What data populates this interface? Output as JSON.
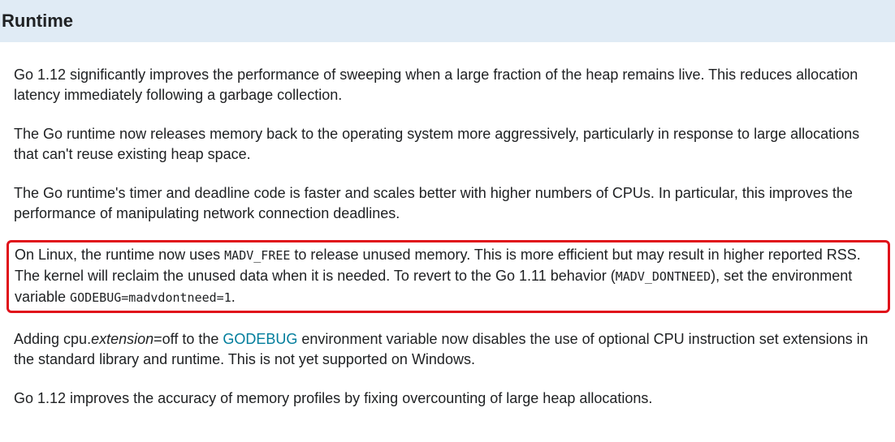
{
  "section": {
    "title": "Runtime"
  },
  "paragraphs": {
    "p1": "Go 1.12 significantly improves the performance of sweeping when a large fraction of the heap remains live. This reduces allocation latency immediately following a garbage collection.",
    "p2": "The Go runtime now releases memory back to the operating system more aggressively, particularly in response to large allocations that can't reuse existing heap space.",
    "p3": "The Go runtime's timer and deadline code is faster and scales better with higher numbers of CPUs. In particular, this improves the performance of manipulating network connection deadlines.",
    "p4": {
      "t1": "On Linux, the runtime now uses ",
      "code1": "MADV_FREE",
      "t2": " to release unused memory. This is more efficient but may result in higher reported RSS. The kernel will reclaim the unused data when it is needed. To revert to the Go 1.11 behavior (",
      "code2": "MADV_DONTNEED",
      "t3": "), set the environment variable ",
      "code3": "GODEBUG=madvdontneed=1",
      "t4": "."
    },
    "p5": {
      "t1": "Adding cpu.",
      "em": "extension",
      "t2": "=off to the ",
      "link": "GODEBUG",
      "t3": " environment variable now disables the use of optional CPU instruction set extensions in the standard library and runtime. This is not yet supported on Windows."
    },
    "p6": "Go 1.12 improves the accuracy of memory profiles by fixing overcounting of large heap allocations."
  },
  "colors": {
    "header_bg": "#e0ebf5",
    "highlight_border": "#e0101a",
    "link": "#007d9c"
  }
}
